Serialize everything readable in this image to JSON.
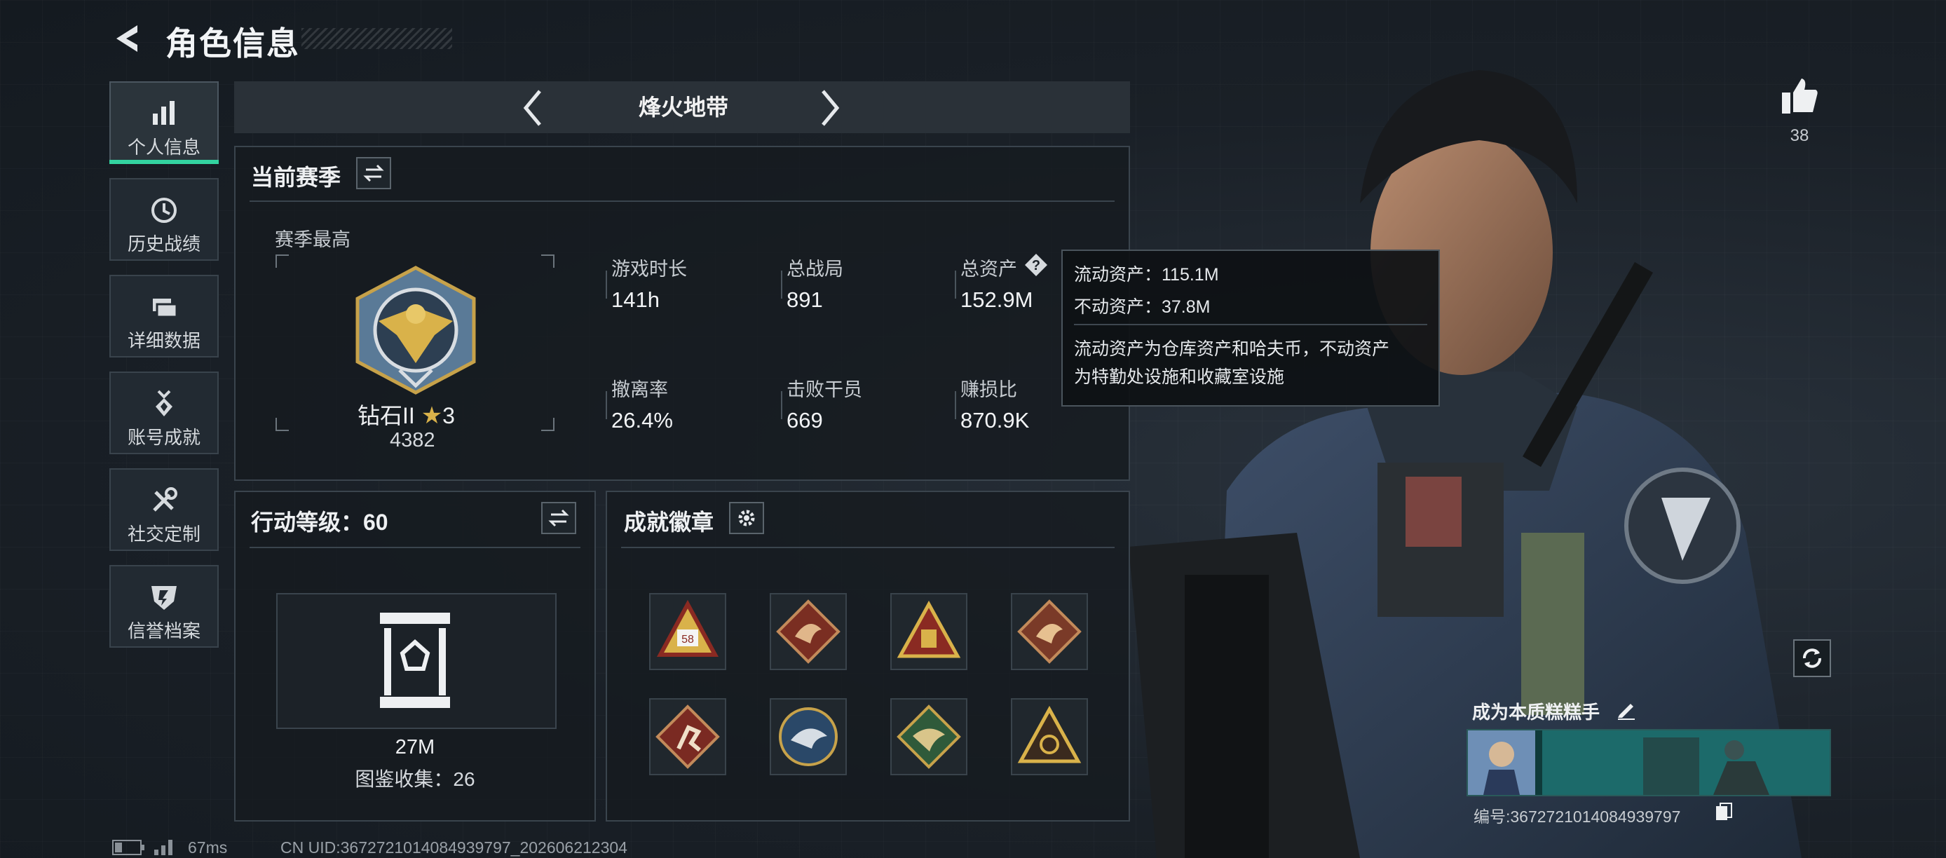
{
  "header": {
    "title": "角色信息"
  },
  "sidebar": {
    "items": [
      {
        "label": "个人信息",
        "icon": "bar-chart-icon",
        "active": true
      },
      {
        "label": "历史战绩",
        "icon": "clock-icon"
      },
      {
        "label": "详细数据",
        "icon": "folder-icon"
      },
      {
        "label": "账号成就",
        "icon": "medal-icon"
      },
      {
        "label": "社交定制",
        "icon": "tools-icon"
      },
      {
        "label": "信誉档案",
        "icon": "shield-icon"
      }
    ]
  },
  "mode": {
    "name": "烽火地带"
  },
  "season": {
    "title": "当前赛季",
    "best_label": "赛季最高",
    "rank_name": "钻石II",
    "rank_stars": "3",
    "rank_score": "4382",
    "stats": [
      {
        "label": "游戏时长",
        "value": "141h"
      },
      {
        "label": "总战局",
        "value": "891"
      },
      {
        "label": "总资产",
        "value": "152.9M"
      },
      {
        "label": "撤离率",
        "value": "26.4%"
      },
      {
        "label": "击败干员",
        "value": "669"
      },
      {
        "label": "赚损比",
        "value": "870.9K"
      }
    ]
  },
  "tooltip": {
    "liquid": "流动资产：115.1M",
    "fixed": "不动资产：37.8M",
    "desc1": "流动资产为仓库资产和哈夫币，不动资产",
    "desc2": "为特勤处设施和收藏室设施"
  },
  "action_level": {
    "title": "行动等级：60",
    "value": "27M",
    "collection": "图鉴收集：26"
  },
  "achievements": {
    "title": "成就徽章",
    "badges": [
      {
        "name": "badge-58"
      },
      {
        "name": "badge-dragon-red"
      },
      {
        "name": "badge-triangle-gold"
      },
      {
        "name": "badge-dragon-brown"
      },
      {
        "name": "badge-runner"
      },
      {
        "name": "badge-eagle-blue"
      },
      {
        "name": "badge-bird-green"
      },
      {
        "name": "badge-triangle-dark"
      }
    ]
  },
  "likes": {
    "count": "38"
  },
  "card": {
    "title": "成为本质糕糕手",
    "id": "编号:3672721014084939797"
  },
  "status": {
    "ping": "67ms",
    "uid": "CN UID:3672721014084939797_202606212304"
  },
  "colors": {
    "accent": "#33d3a0",
    "gold": "#d9b24a"
  }
}
